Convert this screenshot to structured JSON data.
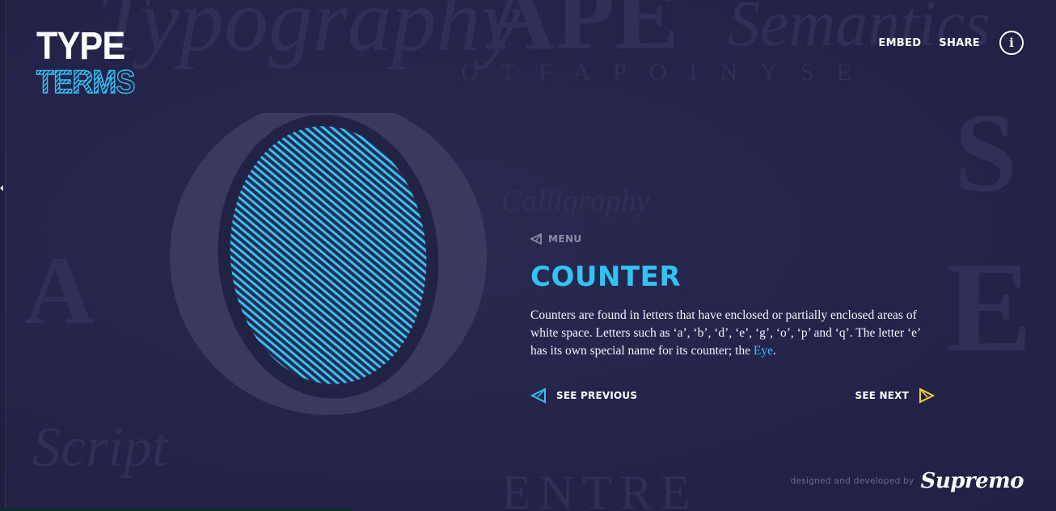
{
  "logo": {
    "line1": "TYPE",
    "line2": "TERMS"
  },
  "topnav": {
    "embed": "EMBED",
    "share": "SHARE",
    "info": "i"
  },
  "icons": {
    "menu": "back-triangle-icon",
    "previous": "previous-triangle-icon",
    "next": "next-triangle-icon",
    "info": "info-circle-icon"
  },
  "colors": {
    "background": "#25254a",
    "accent_blue": "#31c3f4",
    "accent_yellow": "#f4d03a",
    "letter_gray": "#3d3d63",
    "text_white": "#ffffff"
  },
  "term": {
    "menu_label": "MENU",
    "title": "COUNTER",
    "description_text": "Counters are found in letters that have enclosed or partially enclosed areas of white space. Letters such as ‘a’, ‘b’, ‘d’, ‘e’, ‘g’, ‘o’, ‘p’ and ‘q’. The letter ‘e’ has its own special name for its counter; the ",
    "description_link": "Eye",
    "description_end": "."
  },
  "pager": {
    "previous": "SEE PREVIOUS",
    "next": "SEE NEXT"
  },
  "credit": {
    "text": "designed and developed by",
    "brand": "Supremo"
  }
}
